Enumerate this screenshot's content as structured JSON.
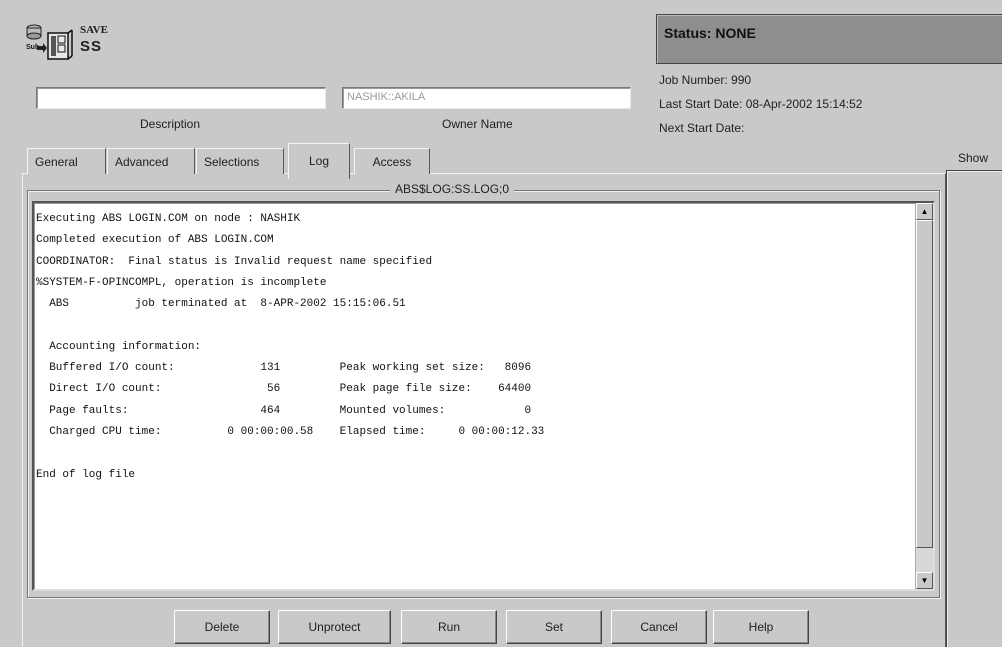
{
  "header": {
    "save_caption": "SAVE",
    "job_name": "SS",
    "icon": "save-job-icon"
  },
  "fields": {
    "description": {
      "label": "Description",
      "value": ""
    },
    "owner": {
      "label": "Owner Name",
      "value": "NASHIK::AKILA"
    }
  },
  "status": {
    "text": "Status: NONE",
    "job_number": "Job Number: 990",
    "last_start": "Last Start Date: 08-Apr-2002 15:14:52",
    "next_start": "Next Start Date:"
  },
  "tabs": [
    {
      "label": "General"
    },
    {
      "label": "Advanced"
    },
    {
      "label": "Selections"
    },
    {
      "label": "Log",
      "active": true
    },
    {
      "label": "Access"
    }
  ],
  "side_panel": {
    "label": "Show"
  },
  "log": {
    "title": "ABS$LOG:SS.LOG;0",
    "text": "Executing ABS LOGIN.COM on node : NASHIK\nCompleted execution of ABS LOGIN.COM\nCOORDINATOR:  Final status is Invalid request name specified\n%SYSTEM-F-OPINCOMPL, operation is incomplete\n  ABS          job terminated at  8-APR-2002 15:15:06.51\n\n  Accounting information:\n  Buffered I/O count:             131         Peak working set size:   8096\n  Direct I/O count:                56         Peak page file size:    64400\n  Page faults:                    464         Mounted volumes:            0\n  Charged CPU time:          0 00:00:00.58    Elapsed time:     0 00:00:12.33\n\nEnd of log file"
  },
  "buttons": {
    "delete": "Delete",
    "unprotect": "Unprotect",
    "run": "Run",
    "set": "Set",
    "cancel": "Cancel",
    "help": "Help"
  }
}
